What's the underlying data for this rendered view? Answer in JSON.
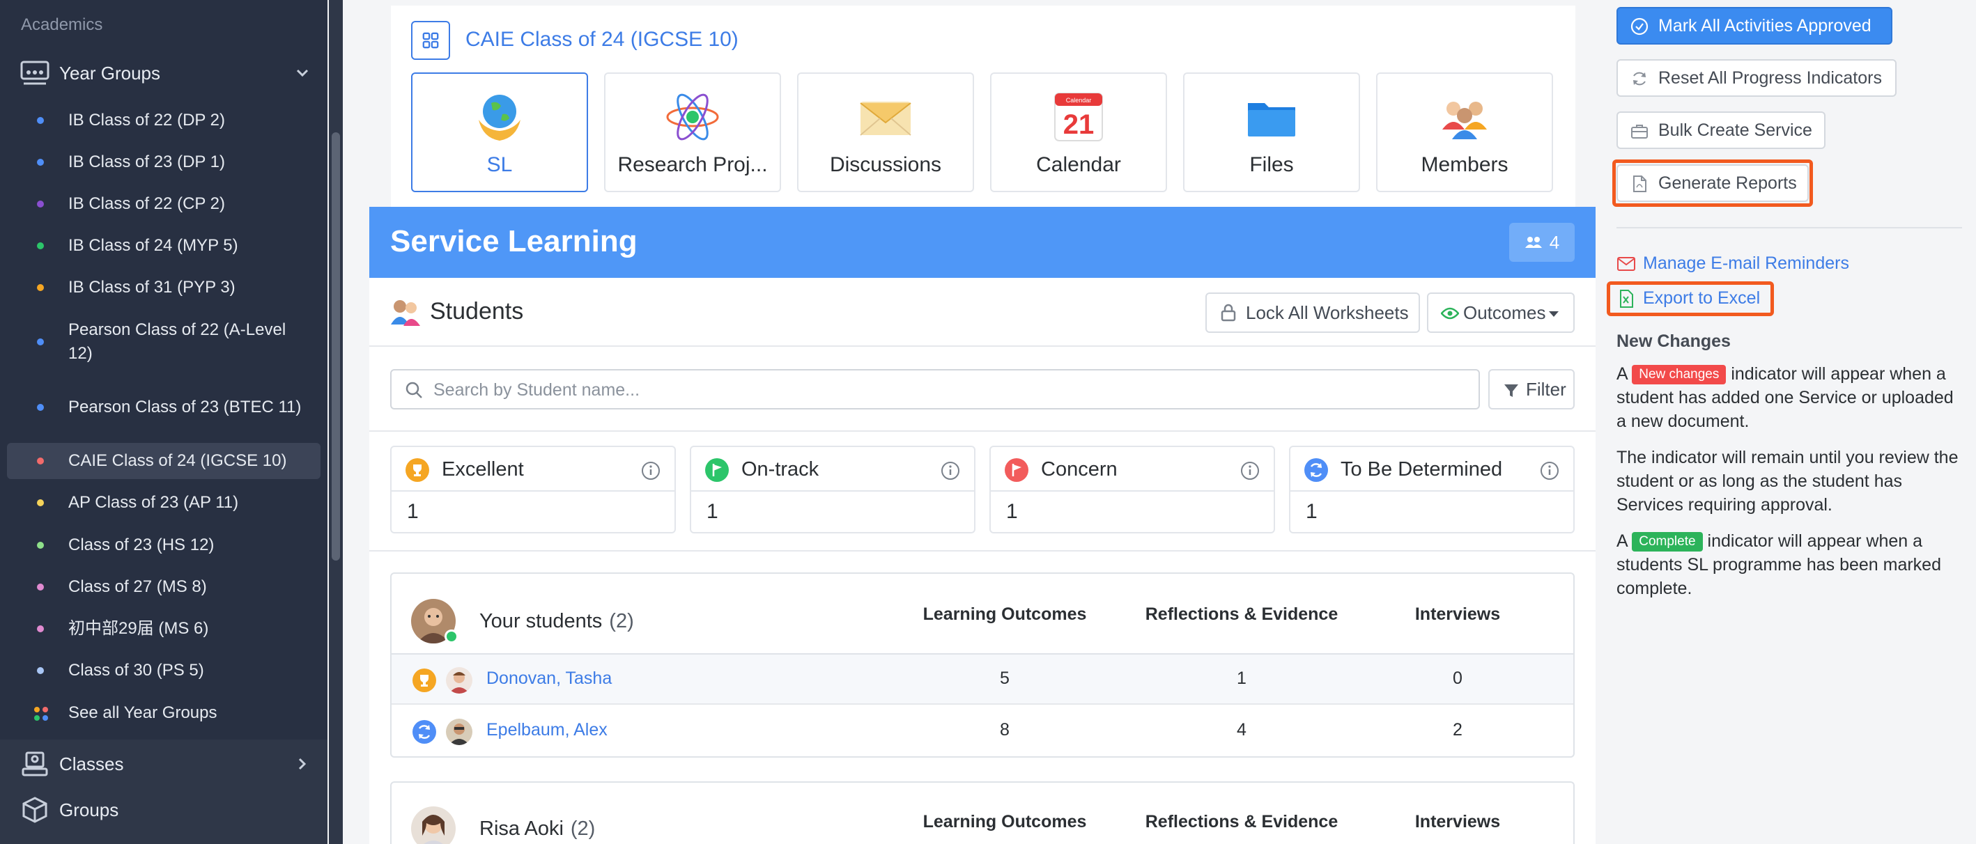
{
  "sidebar": {
    "heading": "Academics",
    "year_groups_label": "Year Groups",
    "items": [
      {
        "label": "IB Class of 22 (DP 2)",
        "color": "#4f8ef7"
      },
      {
        "label": "IB Class of 23 (DP 1)",
        "color": "#4f8ef7"
      },
      {
        "label": "IB Class of 22 (CP 2)",
        "color": "#8a4fd0"
      },
      {
        "label": "IB Class of 24 (MYP 5)",
        "color": "#2cc56a"
      },
      {
        "label": "IB Class of 31 (PYP 3)",
        "color": "#f5a623"
      },
      {
        "label": "Pearson Class of 22 (A-Level 12)",
        "color": "#4f8ef7"
      },
      {
        "label": "Pearson Class of 23 (BTEC 11)",
        "color": "#4f8ef7"
      },
      {
        "label": "CAIE Class of 24 (IGCSE 10)",
        "color": "#f26b6b"
      },
      {
        "label": "AP Class of 23 (AP 11)",
        "color": "#f5d35a"
      },
      {
        "label": "Class of 23 (HS 12)",
        "color": "#8fe08a"
      },
      {
        "label": "Class of 27 (MS 8)",
        "color": "#e08ad0"
      },
      {
        "label": "初中部29届 (MS 6)",
        "color": "#e08ad0"
      },
      {
        "label": "Class of 30 (PS 5)",
        "color": "#a9c6f5"
      }
    ],
    "see_all": "See all Year Groups",
    "classes_label": "Classes",
    "groups_label": "Groups"
  },
  "workspace": {
    "title": "CAIE Class of 24 (IGCSE 10)",
    "tiles": [
      {
        "label": "SL",
        "icon": "globe-hands-icon"
      },
      {
        "label": "Research Proj...",
        "icon": "atom-icon"
      },
      {
        "label": "Discussions",
        "icon": "envelope-icon"
      },
      {
        "label": "Calendar",
        "icon": "calendar-icon",
        "calendar_month": "Calendar",
        "calendar_day": "21"
      },
      {
        "label": "Files",
        "icon": "folder-icon"
      },
      {
        "label": "Members",
        "icon": "people-icon"
      }
    ]
  },
  "service_learning": {
    "title": "Service Learning",
    "member_count": "4",
    "students_title": "Students",
    "lock_button": "Lock All Worksheets",
    "outcomes_button": "Outcomes",
    "search_placeholder": "Search by Student name...",
    "filter_button": "Filter",
    "stats": [
      {
        "label": "Excellent",
        "value": "1",
        "color": "#f5a623"
      },
      {
        "label": "On-track",
        "value": "1",
        "color": "#2cc56a"
      },
      {
        "label": "Concern",
        "value": "1",
        "color": "#f25c5c"
      },
      {
        "label": "To Be Determined",
        "value": "1",
        "color": "#4f8ef7"
      }
    ],
    "columns": {
      "outcomes": "Learning Outcomes",
      "reflections": "Reflections & Evidence",
      "interviews": "Interviews"
    },
    "groups": [
      {
        "name": "Your students",
        "count": "(2)",
        "students": [
          {
            "name": "Donovan, Tasha",
            "status": "excellent",
            "outcomes": "5",
            "reflections": "1",
            "interviews": "0"
          },
          {
            "name": "Epelbaum, Alex",
            "status": "to-be-determined",
            "outcomes": "8",
            "reflections": "4",
            "interviews": "2"
          }
        ]
      },
      {
        "name": "Risa Aoki",
        "count": "(2)",
        "students": []
      }
    ]
  },
  "right_panel": {
    "approve_button": "Mark All Activities Approved",
    "reset_button": "Reset All Progress Indicators",
    "bulk_button": "Bulk Create Service",
    "reports_button": "Generate Reports",
    "email_link": "Manage E-mail Reminders",
    "export_link": "Export to Excel",
    "new_changes_title": "New Changes",
    "para1_a": "A",
    "new_changes_tag": "New changes",
    "para1_b": "indicator will appear when a student has added one Service or uploaded a new document.",
    "para2": "The indicator will remain until you review the student or as long as the student has Services requiring approval.",
    "para3_a": "A",
    "complete_tag": "Complete",
    "para3_b": "indicator will appear when a students SL programme has been marked complete."
  }
}
